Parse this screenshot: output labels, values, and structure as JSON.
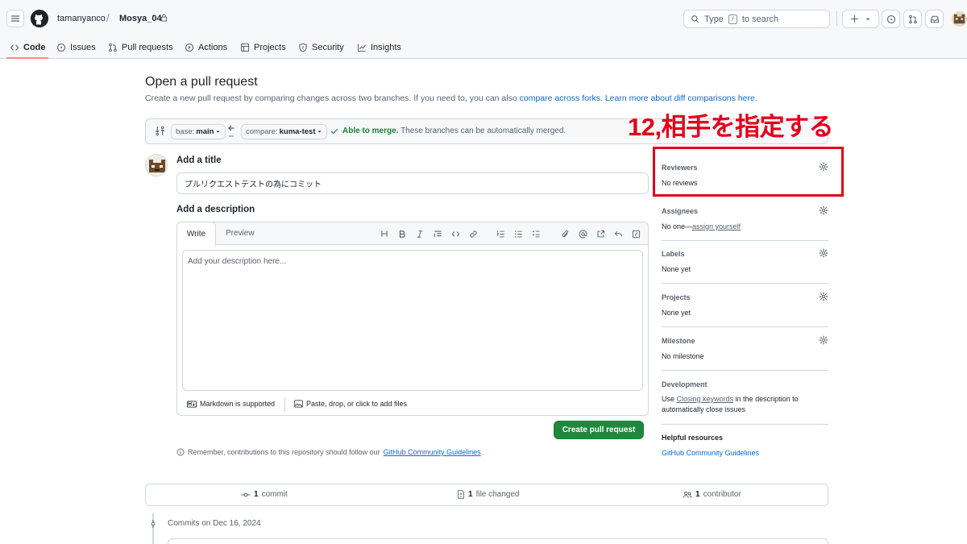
{
  "header": {
    "owner": "tamanyanco",
    "separator": "/",
    "repo": "Mosya_04",
    "search_prefix": "Type",
    "search_key": "/",
    "search_suffix": "to search"
  },
  "repo_nav": {
    "items": [
      {
        "label": "Code",
        "icon": "code-icon",
        "active": true
      },
      {
        "label": "Issues",
        "icon": "issue-icon"
      },
      {
        "label": "Pull requests",
        "icon": "pull-request-icon"
      },
      {
        "label": "Actions",
        "icon": "play-icon"
      },
      {
        "label": "Projects",
        "icon": "table-icon"
      },
      {
        "label": "Security",
        "icon": "shield-icon"
      },
      {
        "label": "Insights",
        "icon": "graph-icon"
      }
    ]
  },
  "page": {
    "title": "Open a pull request",
    "subtitle_text": "Create a new pull request by comparing changes across two branches. If you need to, you can also ",
    "subtitle_link1": "compare across forks.",
    "subtitle_link2": "Learn more about diff comparisons here."
  },
  "compare": {
    "base_prefix": "base:",
    "base_branch": "main",
    "compare_prefix": "compare:",
    "compare_branch": "kuma-test",
    "merge_status": "Able to merge.",
    "merge_detail": "These branches can be automatically merged."
  },
  "form": {
    "title_label": "Add a title",
    "title_value": "プルリクエストテストの為にコミット",
    "description_label": "Add a description",
    "tab_write": "Write",
    "tab_preview": "Preview",
    "description_placeholder": "Add your description here...",
    "markdown_note": "Markdown is supported",
    "attach_note": "Paste, drop, or click to add files",
    "submit_label": "Create pull request",
    "remember_text": "Remember, contributions to this repository should follow our",
    "remember_link": "GitHub Community Guidelines",
    "remember_end": "."
  },
  "sidebar": {
    "reviewers": {
      "title": "Reviewers",
      "value": "No reviews"
    },
    "assignees": {
      "title": "Assignees",
      "value_prefix": "No one—",
      "value_link": "assign yourself"
    },
    "labels": {
      "title": "Labels",
      "value": "None yet"
    },
    "projects": {
      "title": "Projects",
      "value": "None yet"
    },
    "milestone": {
      "title": "Milestone",
      "value": "No milestone"
    },
    "development": {
      "title": "Development",
      "text_prefix": "Use ",
      "link": "Closing keywords",
      "text_suffix": " in the description to automatically close issues"
    },
    "helpful": {
      "title": "Helpful resources",
      "link": "GitHub Community Guidelines"
    }
  },
  "annotation": {
    "text": "12,相手を指定する",
    "color": "#e3001b"
  },
  "stats": {
    "commits_count": "1",
    "commits_label": "commit",
    "files_count": "1",
    "files_label": "file changed",
    "contributors_count": "1",
    "contributors_label": "contributor"
  },
  "commits": {
    "date_heading": "Commits on Dec 16, 2024"
  },
  "colors": {
    "accent_green": "#1f883d",
    "link_blue": "#0969da",
    "nav_underline": "#fd8c73",
    "border": "#d0d7de"
  }
}
